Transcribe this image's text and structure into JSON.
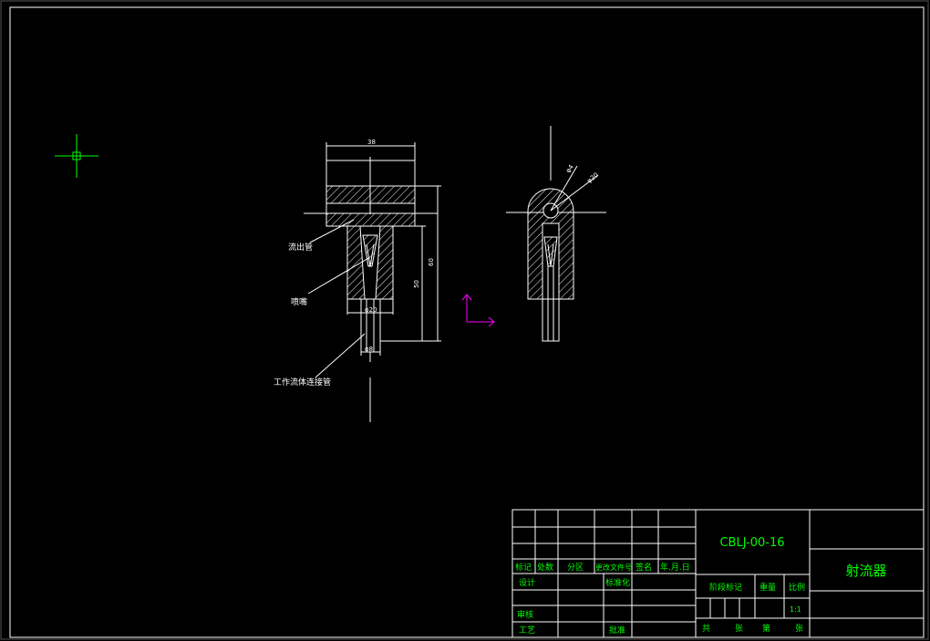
{
  "drawing": {
    "labels": {
      "outflow_pipe": "流出管",
      "nozzle": "喷嘴",
      "working_fluid_connection": "工作流体连接管"
    },
    "dimensions": {
      "width_38": "38",
      "height_60": "60",
      "height_50": "50",
      "dia_20": "φ20",
      "dia_8": "φ8",
      "right_dia_4": "φ4",
      "right_dia_20": "φ20"
    }
  },
  "title_block": {
    "drawing_number": "CBLJ-00-16",
    "part_name": "射流器",
    "header_row": [
      "标记",
      "处数",
      "分区",
      "更改文件号",
      "签名",
      "年.月.日"
    ],
    "design": "设计",
    "standardization": "标准化",
    "review": "审核",
    "process": "工艺",
    "approval": "批准",
    "stage_mark": "阶段标记",
    "weight": "重量",
    "scale_label": "比例",
    "scale_value": "1:1",
    "sheet_total": "共",
    "sheet_unit": "张",
    "sheet_index": "第",
    "sheet_unit2": "张"
  },
  "colors": {
    "background": "#000000",
    "lines": "#ffffff",
    "title_text": "#00ff00",
    "ucs_icon": "#ff00ff",
    "crosshair": "#00ff00"
  }
}
